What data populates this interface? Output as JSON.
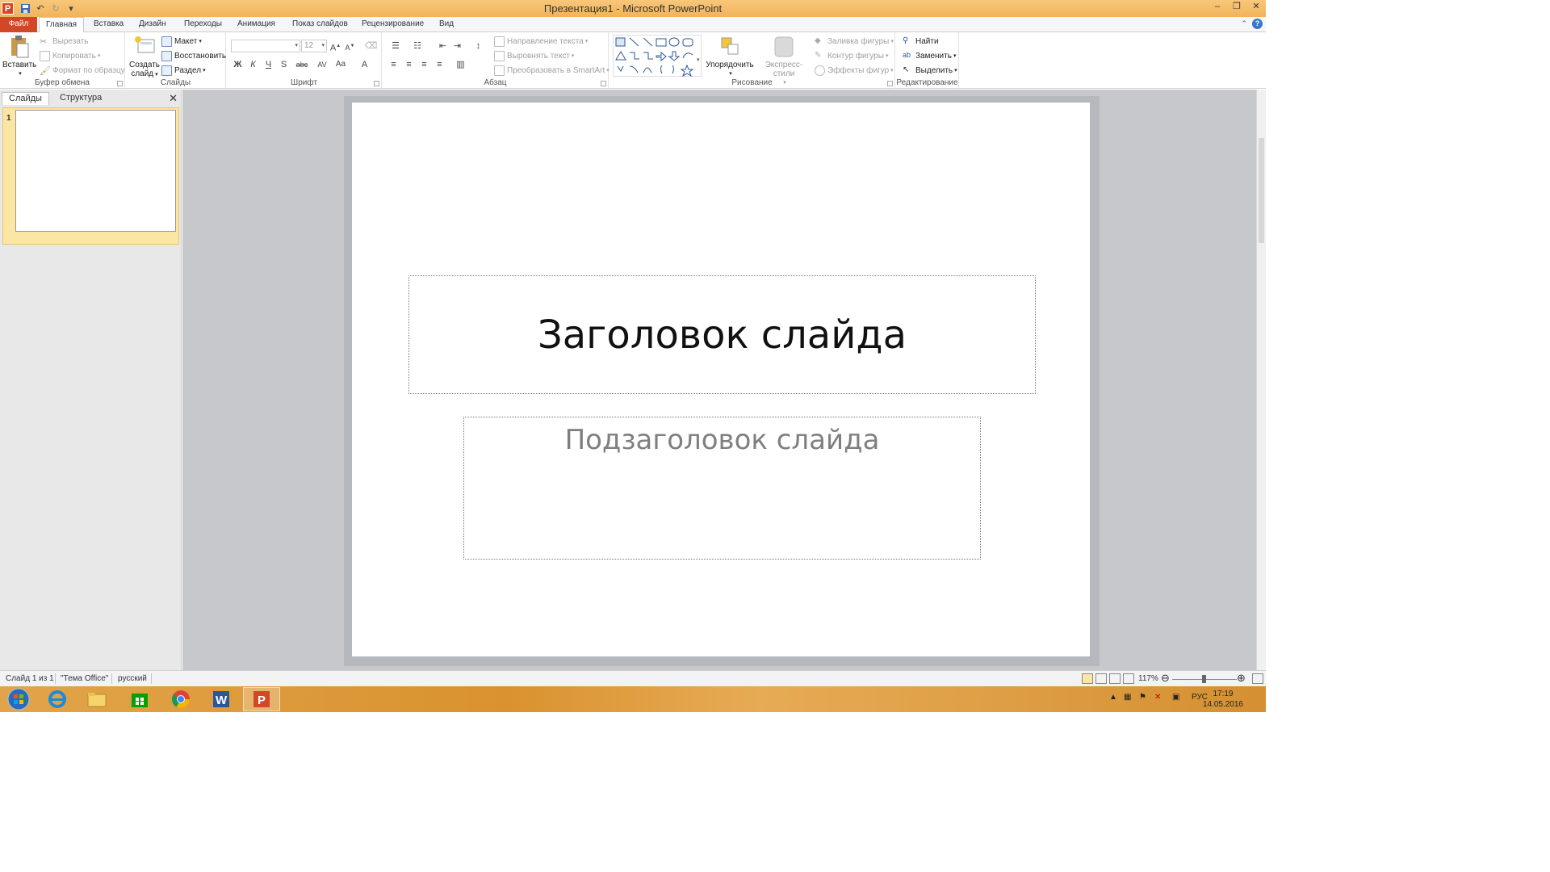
{
  "window": {
    "title": "Презентация1  -  Microsoft PowerPoint",
    "app_icon_letter": "P",
    "minimize": "–",
    "restore": "❐",
    "close": "✕"
  },
  "tabs": {
    "file": "Файл",
    "items": [
      "Главная",
      "Вставка",
      "Дизайн",
      "Переходы",
      "Анимация",
      "Показ слайдов",
      "Рецензирование",
      "Вид"
    ],
    "active_index": 0
  },
  "ribbon": {
    "clipboard": {
      "label": "Буфер обмена",
      "paste": "Вставить",
      "cut": "Вырезать",
      "copy": "Копировать",
      "format_painter": "Формат по образцу"
    },
    "slides": {
      "label": "Слайды",
      "new_slide_line1": "Создать",
      "new_slide_line2": "слайд",
      "layout": "Макет",
      "reset": "Восстановить",
      "section": "Раздел"
    },
    "font": {
      "label": "Шрифт",
      "size": "12",
      "bold": "Ж",
      "italic": "К",
      "underline": "Ч",
      "strike": "S",
      "shadow": "abc",
      "spacing": "AV",
      "case": "Aa",
      "color": "A"
    },
    "paragraph": {
      "label": "Абзац",
      "text_direction": "Направление текста",
      "align_text": "Выровнять текст",
      "smartart": "Преобразовать в SmartArt"
    },
    "drawing": {
      "label": "Рисование",
      "arrange": "Упорядочить",
      "quick_styles": "Экспресс-стили",
      "shape_fill": "Заливка фигуры",
      "shape_outline": "Контур фигуры",
      "shape_effects": "Эффекты фигур"
    },
    "editing": {
      "label": "Редактирование",
      "find": "Найти",
      "replace": "Заменить",
      "select": "Выделить"
    }
  },
  "left_panel": {
    "tab_slides": "Слайды",
    "tab_outline": "Структура",
    "close": "✕",
    "slide_number": "1"
  },
  "slide": {
    "title": "Заголовок слайда",
    "subtitle": "Подзаголовок слайда"
  },
  "status": {
    "slide_info": "Слайд 1 из 1",
    "theme": "\"Тема Office\"",
    "language": "русский",
    "zoom": "117%"
  },
  "taskbar": {
    "language": "РУС",
    "time": "17:19",
    "date": "14.05.2016"
  }
}
